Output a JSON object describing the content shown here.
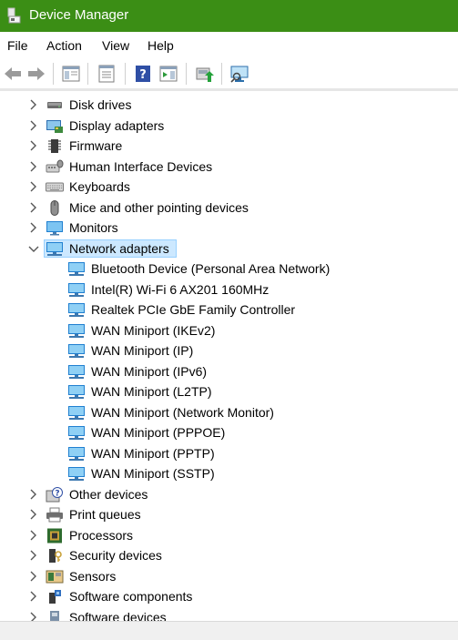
{
  "window": {
    "title": "Device Manager"
  },
  "menu": [
    "File",
    "Action",
    "View",
    "Help"
  ],
  "toolbar": [
    "back-icon",
    "forward-icon",
    "show-hide-console-tree-icon",
    "properties-icon",
    "help-icon",
    "action-pane-icon",
    "update-driver-icon",
    "scan-hardware-changes-icon"
  ],
  "tree": {
    "categories_before": [
      {
        "label": "Disk drives",
        "icon": "disk-drive-icon"
      },
      {
        "label": "Display adapters",
        "icon": "display-adapter-icon"
      },
      {
        "label": "Firmware",
        "icon": "firmware-icon"
      },
      {
        "label": "Human Interface Devices",
        "icon": "hid-icon"
      },
      {
        "label": "Keyboards",
        "icon": "keyboard-icon"
      },
      {
        "label": "Mice and other pointing devices",
        "icon": "mouse-icon"
      },
      {
        "label": "Monitors",
        "icon": "monitor-icon"
      }
    ],
    "expanded": {
      "label": "Network adapters",
      "icon": "network-adapter-icon",
      "selected": true,
      "children": [
        "Bluetooth Device (Personal Area Network)",
        "Intel(R) Wi-Fi 6 AX201 160MHz",
        "Realtek PCIe GbE Family Controller",
        "WAN Miniport (IKEv2)",
        "WAN Miniport (IP)",
        "WAN Miniport (IPv6)",
        "WAN Miniport (L2TP)",
        "WAN Miniport (Network Monitor)",
        "WAN Miniport (PPPOE)",
        "WAN Miniport (PPTP)",
        "WAN Miniport (SSTP)"
      ]
    },
    "categories_after": [
      {
        "label": "Other devices",
        "icon": "unknown-device-icon"
      },
      {
        "label": "Print queues",
        "icon": "printer-icon"
      },
      {
        "label": "Processors",
        "icon": "processor-icon"
      },
      {
        "label": "Security devices",
        "icon": "security-device-icon"
      },
      {
        "label": "Sensors",
        "icon": "sensor-icon"
      },
      {
        "label": "Software components",
        "icon": "software-component-icon"
      },
      {
        "label": "Software devices",
        "icon": "software-device-icon"
      }
    ]
  },
  "colors": {
    "titlebar": "#3b8e15",
    "selection": "#cce8ff",
    "selection_border": "#99d1ff"
  }
}
